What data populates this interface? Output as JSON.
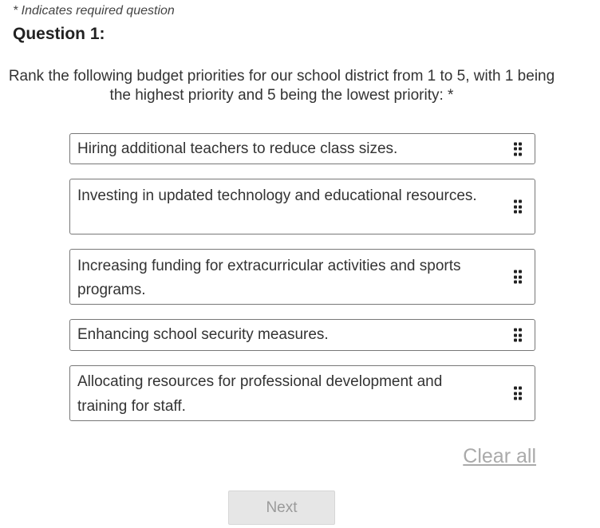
{
  "header": {
    "required_note": "* Indicates required question",
    "question_title": "Question 1:"
  },
  "question": {
    "text": "Rank the following budget priorities for our school district from 1 to 5, with 1 being the highest priority and 5 being the lowest priority: *"
  },
  "rank_items": [
    {
      "label": "Hiring additional teachers to reduce class sizes."
    },
    {
      "label": "Investing in updated technology and educational resources."
    },
    {
      "label": "Increasing funding for extracurricular activities and sports programs."
    },
    {
      "label": "Enhancing school security measures."
    },
    {
      "label": "Allocating resources for professional development and training for staff."
    }
  ],
  "actions": {
    "clear_all_label": "Clear all",
    "next_label": "Next",
    "next_disabled": true
  },
  "icons": {
    "drag_handle": "drag-handle-icon"
  },
  "colors": {
    "link_disabled": "#aaaaaa",
    "button_disabled_bg": "#e6e6e6",
    "button_disabled_text": "#9a9a9a",
    "item_border": "#777777"
  }
}
